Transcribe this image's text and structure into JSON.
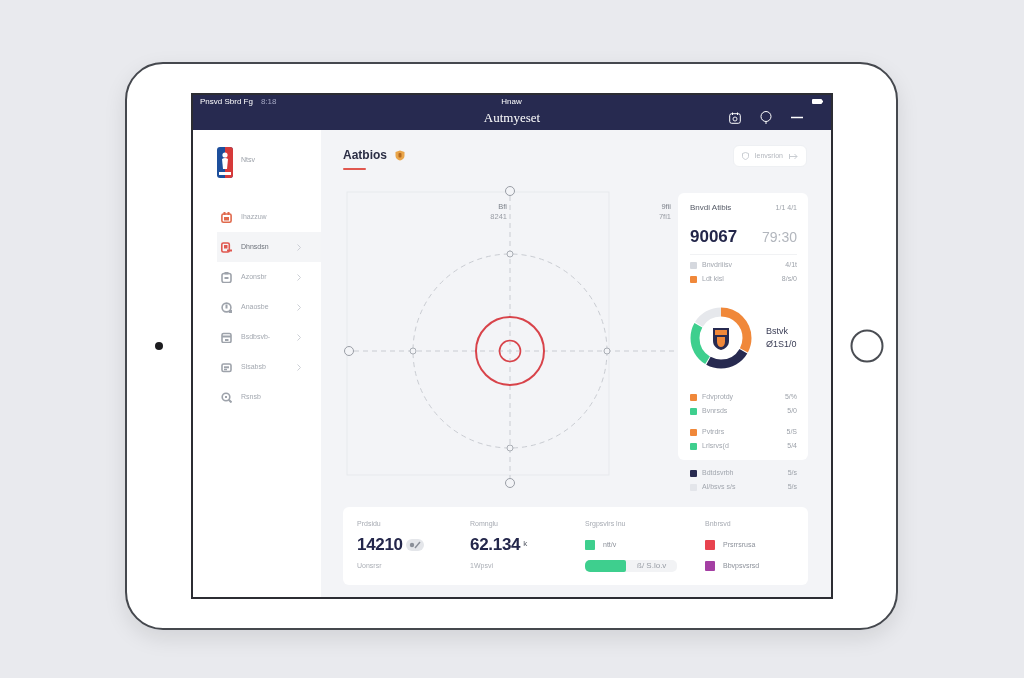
{
  "status_bar": {
    "carrier": "Pnsvd Sbrd Fg",
    "time": "8:18",
    "center": "Hnaw"
  },
  "top_bar": {
    "title": "Autmyeset"
  },
  "sidebar": {
    "brand": "Ntsv",
    "items": [
      {
        "label": "Ihazzuw",
        "selected": false,
        "expandable": false,
        "color": "#e0694c"
      },
      {
        "label": "Dhnsdsn",
        "selected": true,
        "expandable": true,
        "color": "#e0574f"
      },
      {
        "label": "Azonsbr",
        "selected": false,
        "expandable": true,
        "color": "#9ea3ab"
      },
      {
        "label": "Anaosbe",
        "selected": false,
        "expandable": true,
        "color": "#9ea3ab"
      },
      {
        "label": "Bsdbsvb-",
        "selected": false,
        "expandable": true,
        "color": "#9ea3ab"
      },
      {
        "label": "Slsabsb",
        "selected": false,
        "expandable": true,
        "color": "#9ea3ab"
      },
      {
        "label": "Rsnsb",
        "selected": false,
        "expandable": false,
        "color": "#9ea3ab"
      }
    ]
  },
  "main": {
    "heading": "Aatbios",
    "action_button": "Ienvsrion",
    "diagram_labels": [
      {
        "title": "Bfi",
        "value": "8241"
      },
      {
        "title": "9fii",
        "value": "7fi1"
      }
    ],
    "summary_card": {
      "title": "Bnvdi Atibis",
      "meta": "1/1 4/1",
      "total": "90067",
      "time": "79:30",
      "legend_top": [
        {
          "label": "Bnvdriiisv",
          "value": "4/1t",
          "color": "#d5d8de"
        },
        {
          "label": "Ldt kisl",
          "value": "8/s/0",
          "color": "#f0883a"
        }
      ],
      "donut_caption": {
        "title": "Bstvk",
        "value": "Ø1S1/0"
      },
      "legend_groups": [
        [
          {
            "label": "Fdvprotdy",
            "value": "5/%",
            "color": "#f0883a"
          },
          {
            "label": "Bvnrsds",
            "value": "5/0",
            "color": "#3ecf8e"
          }
        ],
        [
          {
            "label": "Pvtrdrs",
            "value": "5/S",
            "color": "#f0883a"
          },
          {
            "label": "Lrlsrvs(d",
            "value": "5/4",
            "color": "#3ecf8e"
          }
        ]
      ]
    },
    "extra_legend": [
      {
        "label": "Bdtdsvrbh",
        "value": "5/s",
        "color": "#272a50"
      },
      {
        "label": "Al/bsvs s/s",
        "value": "5/s",
        "color": "#e3e5ea"
      }
    ],
    "stats": [
      {
        "kind": "value",
        "label": "Prdsidu",
        "value": "14210",
        "has_badge": true,
        "note": "Uonsrsr"
      },
      {
        "kind": "value",
        "label": "Romnglu",
        "value": "62.134",
        "unit": "k",
        "has_badge": false,
        "note": "1Wpsvi"
      },
      {
        "kind": "progress",
        "label": "Srgpsvirs lnu",
        "legend": {
          "label": "ntt/v",
          "color": "#3ecf8e"
        },
        "level": 0.45,
        "reading": "ß/ S.lo.v"
      },
      {
        "kind": "legend",
        "label": "Bnbrsvd",
        "items": [
          {
            "label": "Prsrrsrusa",
            "color": "#e8434f"
          },
          {
            "label": "Bbvpsvsrsd",
            "color": "#a43fa3"
          }
        ]
      }
    ]
  }
}
